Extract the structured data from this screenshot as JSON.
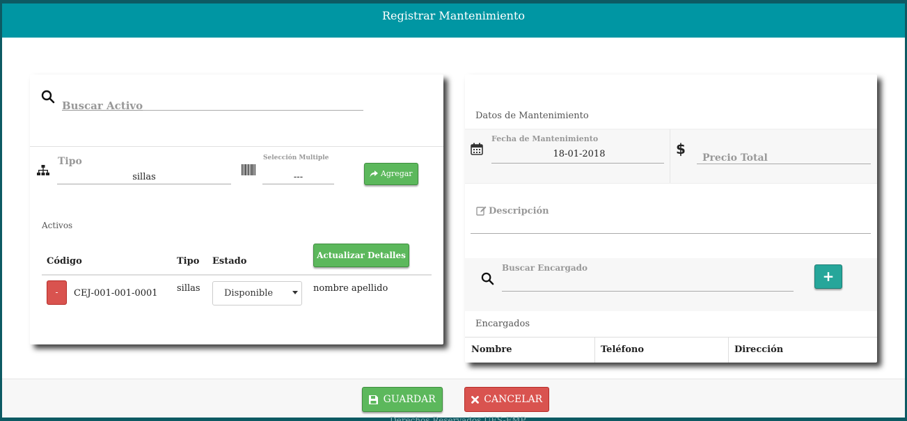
{
  "modal": {
    "title": "Registrar Mantenimiento"
  },
  "left": {
    "search_placeholder": "Buscar Activo",
    "tipo_label": "Tipo",
    "tipo_value": "sillas",
    "multi_label": "Selección Multiple",
    "multi_value": "---",
    "add_label": "Agregar",
    "activos_label": "Activos",
    "update_label": "Actualizar Detalles",
    "table": {
      "headers": {
        "codigo": "Código",
        "tipo": "Tipo",
        "estado": "Estado"
      },
      "rows": [
        {
          "remove": "-",
          "codigo": "CEJ-001-001-0001",
          "tipo": "sillas",
          "estado": "Disponible",
          "encargado": "nombre apellido"
        }
      ]
    }
  },
  "right": {
    "datos_label": "Datos de Mantenimiento",
    "fecha_label": "Fecha de Mantenimiento",
    "fecha_value": "18-01-2018",
    "currency_symbol": "$",
    "precio_placeholder": "Precio Total",
    "descripcion_placeholder": "Descripción",
    "buscar_encargado_label": "Buscar Encargado",
    "add_encargado": "+",
    "encargados_label": "Encargados",
    "table_headers": {
      "nombre": "Nombre",
      "telefono": "Teléfono",
      "direccion": "Dirección"
    }
  },
  "footer": {
    "guardar": "GUARDAR",
    "cancelar": "CANCELAR",
    "background_text": "Derechos Reservados UES-FMP"
  },
  "colors": {
    "header": "#0096a3",
    "success": "#5cb85c",
    "danger": "#d9534f",
    "teal": "#26a69a"
  }
}
